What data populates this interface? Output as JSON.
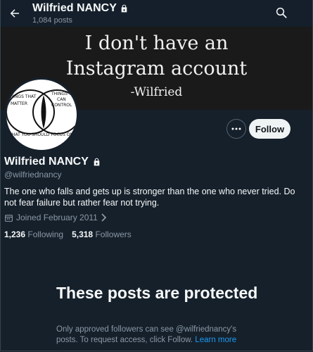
{
  "header": {
    "name": "Wilfried NANCY",
    "posts_count": "1,084 posts"
  },
  "banner": {
    "line1": "I don't have an",
    "line2": "Instagram account",
    "line3": "-Wilfried"
  },
  "avatar": {
    "text_left": "THINGS THAT MATTER",
    "text_right": "THINGS YOU CAN CONTROL",
    "text_bottom": "WHAT YOU SHOULD FOCUS ON"
  },
  "actions": {
    "follow_label": "Follow"
  },
  "profile": {
    "name": "Wilfried NANCY",
    "handle": "@wilfriednancy",
    "bio": "The one who falls and gets up is stronger than the one who never tried. Do not fear failure but rather fear not trying.",
    "joined": "Joined February 2011",
    "following_count": "1,236",
    "following_label": "Following",
    "followers_count": "5,318",
    "followers_label": "Followers"
  },
  "protected": {
    "title": "These posts are protected",
    "description": "Only approved followers can see @wilfriednancy's posts. To request access, click Follow.",
    "learn_more": "Learn more"
  },
  "colors": {
    "background": "#15202b",
    "accent": "#1d9bf0",
    "muted": "#8b98a5"
  }
}
